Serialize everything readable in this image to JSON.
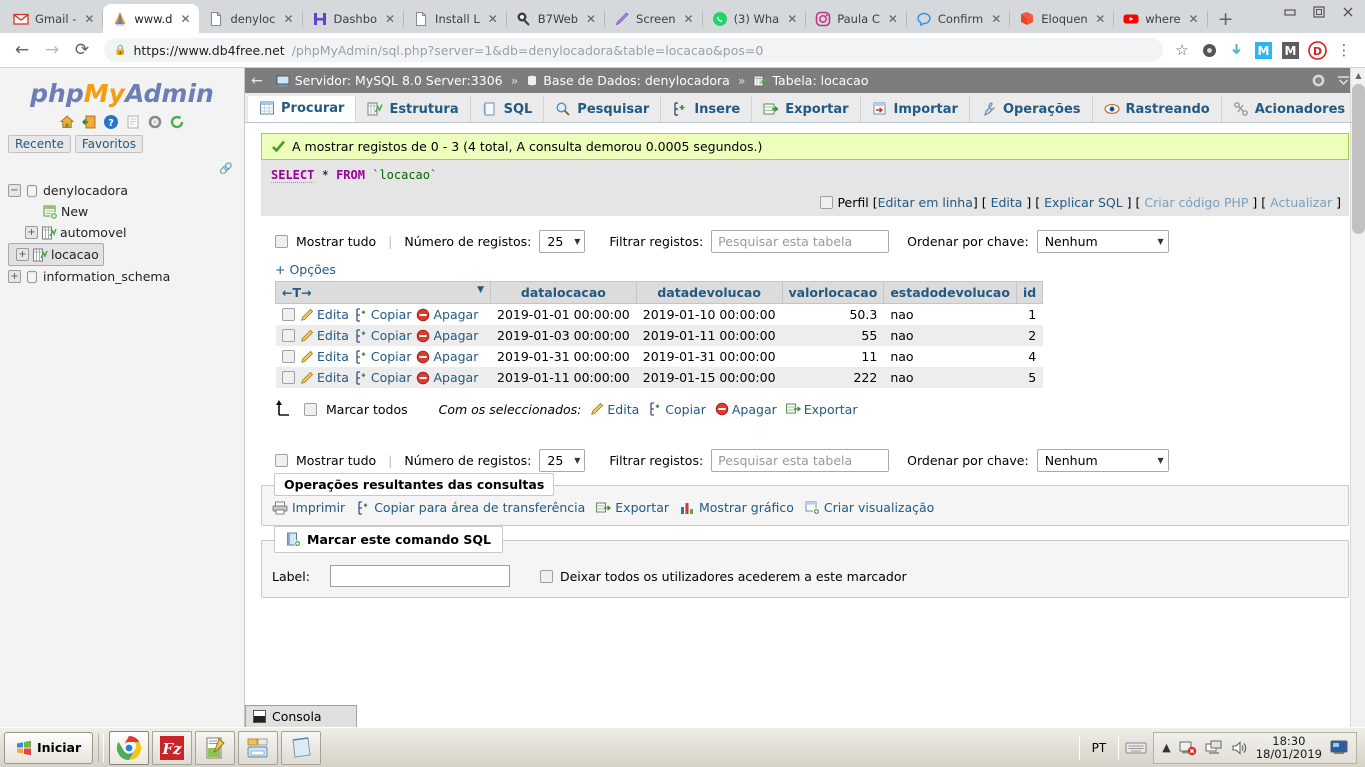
{
  "browser": {
    "tabs": [
      {
        "label": "Gmail -",
        "icon": "gmail-icon",
        "active": false
      },
      {
        "label": "www.d",
        "icon": "phpmyadmin-icon",
        "active": true
      },
      {
        "label": "denyloc",
        "icon": "page-icon",
        "active": false
      },
      {
        "label": "Dashbo",
        "icon": "h-icon",
        "active": false
      },
      {
        "label": "Install L",
        "icon": "page-icon",
        "active": false
      },
      {
        "label": "B7Web",
        "icon": "b7web-icon",
        "active": false
      },
      {
        "label": "Screen",
        "icon": "pen-icon",
        "active": false
      },
      {
        "label": "(3) Wha",
        "icon": "whatsapp-icon",
        "active": false
      },
      {
        "label": "Paula C",
        "icon": "instagram-icon",
        "active": false
      },
      {
        "label": "Confirm",
        "icon": "messenger-icon",
        "active": false
      },
      {
        "label": "Eloquen",
        "icon": "laravel-icon",
        "active": false
      },
      {
        "label": "where",
        "icon": "youtube-icon",
        "active": false
      }
    ],
    "new_tab_label": "+",
    "close_label": "✕",
    "window_controls": [
      "minimize",
      "restore",
      "close"
    ],
    "url_prefix": "https://www.db4free.net",
    "url_rest": "/phpMyAdmin/sql.php?server=1&db=denylocadora&table=locacao&pos=0",
    "back_label": "←",
    "forward_label": "→",
    "reload_label": "⟳",
    "star_label": "☆",
    "menu_label": "⋮",
    "extension_badges": [
      "M",
      "M",
      "D"
    ]
  },
  "sidebar": {
    "logo": {
      "php": "php",
      "my": "My",
      "admin": "Admin"
    },
    "icons": [
      "home-icon",
      "logout-icon",
      "help-icon",
      "docs-icon",
      "settings-icon",
      "reload-icon"
    ],
    "tabs": [
      "Recente",
      "Favoritos"
    ],
    "tree": [
      {
        "label": "denylocadora",
        "level": 0,
        "toggle": "minus",
        "icon": "database-icon",
        "selected": false
      },
      {
        "label": "New",
        "level": 2,
        "toggle": "none",
        "icon": "new-table-icon",
        "selected": false
      },
      {
        "label": "automovel",
        "level": 1,
        "toggle": "plus",
        "icon": "table-icon",
        "selected": false
      },
      {
        "label": "locacao",
        "level": 1,
        "toggle": "plus",
        "icon": "table-icon",
        "selected": true
      },
      {
        "label": "information_schema",
        "level": 0,
        "toggle": "plus",
        "icon": "database-icon",
        "selected": false
      }
    ]
  },
  "breadcrumb": {
    "back_arrow": "←",
    "server_label": "Servidor: MySQL 8.0 Server:3306",
    "db_label": "Base de Dados: denylocadora",
    "table_label": "Tabela: locacao",
    "separator": "»",
    "settings_icon": "gear-icon",
    "collapse_icon": "collapse-icon"
  },
  "tabs": [
    {
      "label": "Procurar",
      "icon": "browse-icon",
      "active": true
    },
    {
      "label": "Estrutura",
      "icon": "structure-icon",
      "active": false
    },
    {
      "label": "SQL",
      "icon": "sql-icon",
      "active": false
    },
    {
      "label": "Pesquisar",
      "icon": "search-icon",
      "active": false
    },
    {
      "label": "Insere",
      "icon": "insert-icon",
      "active": false
    },
    {
      "label": "Exportar",
      "icon": "export-icon",
      "active": false
    },
    {
      "label": "Importar",
      "icon": "import-icon",
      "active": false
    },
    {
      "label": "Operações",
      "icon": "operations-icon",
      "active": false
    },
    {
      "label": "Rastreando",
      "icon": "tracking-icon",
      "active": false
    },
    {
      "label": "Acionadores",
      "icon": "triggers-icon",
      "active": false
    }
  ],
  "notice": {
    "icon": "check-icon",
    "text": "A mostrar registos de 0 - 3 (4 total, A consulta demorou 0.0005 segundos.)"
  },
  "sql": {
    "keyword1": "SELECT",
    "star": "*",
    "keyword2": "FROM",
    "table": "`locacao`"
  },
  "sql_tools": {
    "profile_label": "Perfil",
    "links": [
      "Editar em linha",
      "Edita",
      "Explicar SQL",
      "Criar código PHP",
      "Actualizar"
    ]
  },
  "controls": {
    "show_all_label": "Mostrar tudo",
    "rows_label": "Número de registos:",
    "rows_value": "25",
    "filter_label": "Filtrar registos:",
    "filter_placeholder": "Pesquisar esta tabela",
    "sort_label": "Ordenar por chave:",
    "sort_value": "Nenhum",
    "options_label": "+ Opções"
  },
  "table": {
    "sort_header": "←T→",
    "columns": [
      "datalocacao",
      "datadevolucao",
      "valorlocacao",
      "estadodevolucao",
      "id"
    ],
    "actions": {
      "edit": "Edita",
      "copy": "Copiar",
      "delete": "Apagar"
    },
    "rows": [
      {
        "datalocacao": "2019-01-01 00:00:00",
        "datadevolucao": "2019-01-10 00:00:00",
        "valorlocacao": "50.3",
        "estadodevolucao": "nao",
        "id": "1"
      },
      {
        "datalocacao": "2019-01-03 00:00:00",
        "datadevolucao": "2019-01-11 00:00:00",
        "valorlocacao": "55",
        "estadodevolucao": "nao",
        "id": "2"
      },
      {
        "datalocacao": "2019-01-31 00:00:00",
        "datadevolucao": "2019-01-31 00:00:00",
        "valorlocacao": "11",
        "estadodevolucao": "nao",
        "id": "4"
      },
      {
        "datalocacao": "2019-01-11 00:00:00",
        "datadevolucao": "2019-01-15 00:00:00",
        "valorlocacao": "222",
        "estadodevolucao": "nao",
        "id": "5"
      }
    ]
  },
  "with_selected": {
    "check_all_label": "Marcar todos",
    "prefix": "Com os seleccionados:",
    "actions": [
      "Edita",
      "Copiar",
      "Apagar",
      "Exportar"
    ]
  },
  "query_ops": {
    "legend": "Operações resultantes das consultas",
    "links": [
      "Imprimir",
      "Copiar para área de transferência",
      "Exportar",
      "Mostrar gráfico",
      "Criar visualização"
    ]
  },
  "bookmark": {
    "legend": "Marcar este comando SQL",
    "label_text": "Label:",
    "label_value": "",
    "checkbox_text": "Deixar todos os utilizadores acederem a este marcador"
  },
  "console": {
    "label": "Consola"
  },
  "taskbar": {
    "start_label": "Iniciar",
    "apps": [
      "chrome-icon",
      "filezilla-icon",
      "notepadpp-icon",
      "explorer-icon",
      "notepad-icon"
    ],
    "language": "PT",
    "time": "18:30",
    "date": "18/01/2019"
  }
}
